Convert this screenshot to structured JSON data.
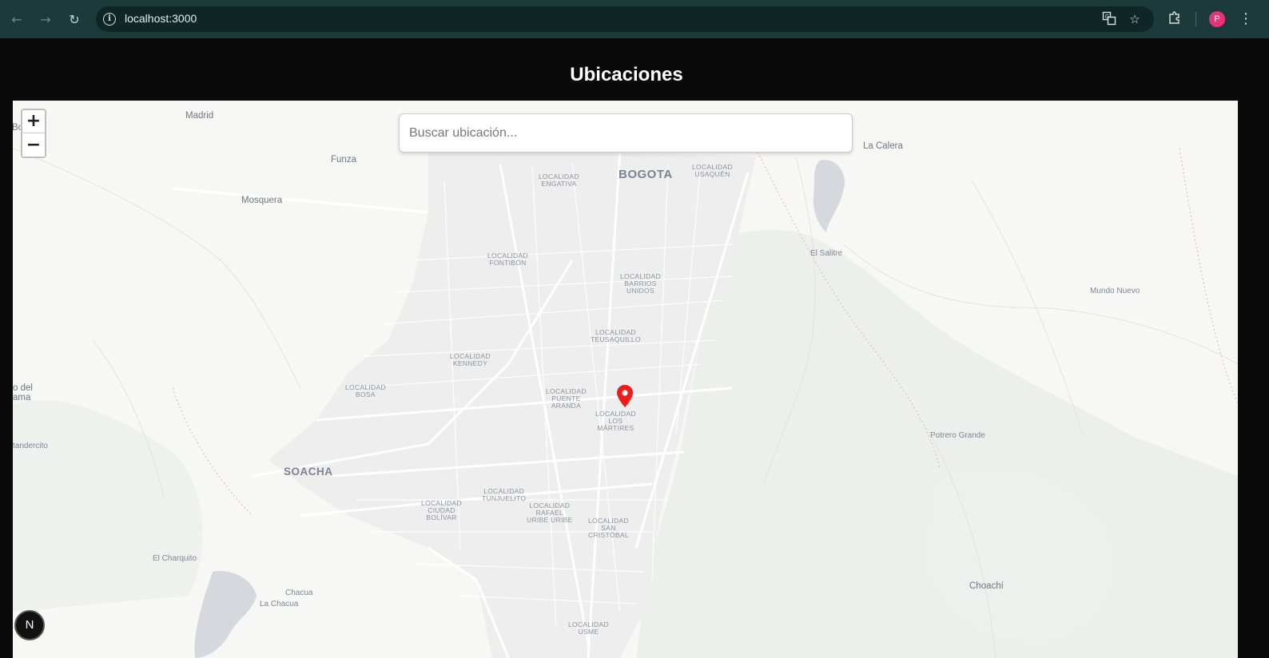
{
  "browser": {
    "url": "localhost:3000",
    "profile_initial": "P"
  },
  "page": {
    "title": "Ubicaciones"
  },
  "map": {
    "search_placeholder": "Buscar ubicación...",
    "zoom_in_label": "+",
    "zoom_out_label": "−",
    "badge_label": "N",
    "marker_color": "#ee1c1c",
    "places": {
      "madrid": "Madrid",
      "funza": "Funza",
      "mosquera": "Mosquera",
      "bogota": "BOGOTA",
      "la_calera": "La Calera",
      "el_salitre": "El Salitre",
      "mundo_nuevo": "Mundo Nuevo",
      "potrero_grande": "Potrero Grande",
      "soacha": "SOACHA",
      "el_charquito": "El Charquito",
      "chacua": "Chacua",
      "la_chacua": "La Chacua",
      "choachi": "Choachí",
      "tandercito": "tandercito",
      "o_del": "o del",
      "ama": "ama",
      "bo": "Bo"
    },
    "localidades": {
      "engativa": [
        "LOCALIDAD",
        "ENGATIVA"
      ],
      "usaquen": [
        "LOCALIDAD",
        "USAQUÉN"
      ],
      "fontibon": [
        "LOCALIDAD",
        "FONTIBÓN"
      ],
      "barrios_unidos": [
        "LOCALIDAD",
        "BARRIOS",
        "UNIDOS"
      ],
      "teusaquillo": [
        "LOCALIDAD",
        "TEUSAQUILLO"
      ],
      "kennedy": [
        "LOCALIDAD",
        "KENNEDY"
      ],
      "bosa": [
        "LOCALIDAD",
        "BOSA"
      ],
      "puente_aranda": [
        "LOCALIDAD",
        "PUENTE",
        "ARANDA"
      ],
      "los_martires": [
        "LOCALIDAD",
        "LOS",
        "MÁRTIRES"
      ],
      "tunjuelito": [
        "LOCALIDAD",
        "TUNJUELITO"
      ],
      "ciudad_bolivar": [
        "LOCALIDAD",
        "CIUDAD",
        "BOLÍVAR"
      ],
      "rafael_uribe": [
        "LOCALIDAD",
        "RAFAEL",
        "URIBE URIBE"
      ],
      "san_cristobal": [
        "LOCALIDAD",
        "SAN",
        "CRISTÓBAL"
      ],
      "usme": [
        "LOCALIDAD",
        "USME"
      ]
    }
  }
}
